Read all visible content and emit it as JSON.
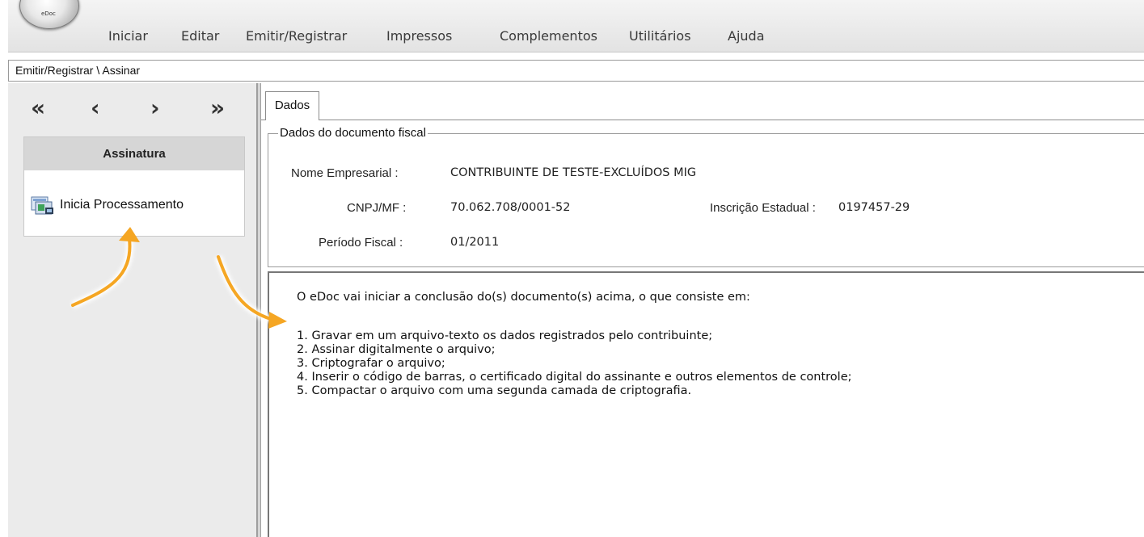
{
  "app": {
    "orb_label": "eDoc"
  },
  "menu": {
    "items": [
      "Iniciar",
      "Editar",
      "Emitir/Registrar",
      "Impressos",
      "Complementos",
      "Utilitários",
      "Ajuda"
    ]
  },
  "breadcrumb": "Emitir/Registrar \\ Assinar",
  "nav": {
    "first": "«",
    "prev": "‹",
    "next": "›",
    "last": "»"
  },
  "sidebar": {
    "section_title": "Assinatura",
    "action_label": "Inicia Processamento",
    "action_icon": "process-icon"
  },
  "tabs": {
    "active": "Dados"
  },
  "fiscal_document": {
    "legend": "Dados do documento fiscal",
    "nome_label": "Nome Empresarial :",
    "nome_value": "CONTRIBUINTE DE TESTE-EXCLUÍDOS MIG",
    "cnpj_label": "CNPJ/MF :",
    "cnpj_value": "70.062.708/0001-52",
    "ie_label": "Inscrição Estadual :",
    "ie_value": "0197457-29",
    "periodo_label": "Período Fiscal :",
    "periodo_value": "01/2011"
  },
  "message": {
    "intro": "O eDoc vai iniciar a conclusão do(s) documento(s) acima, o que consiste em:",
    "steps": [
      "1. Gravar em um arquivo-texto os dados registrados pelo contribuinte;",
      "2. Assinar digitalmente o arquivo;",
      "3. Criptografar o arquivo;",
      "4. Inserir o código de barras, o certificado digital do assinante e outros elementos de controle;",
      "5. Compactar o arquivo com uma segunda camada de criptografia."
    ]
  },
  "colors": {
    "arrow": "#f5a623",
    "panel_bg": "#ebebeb",
    "section_header_bg": "#d6d6d6"
  }
}
